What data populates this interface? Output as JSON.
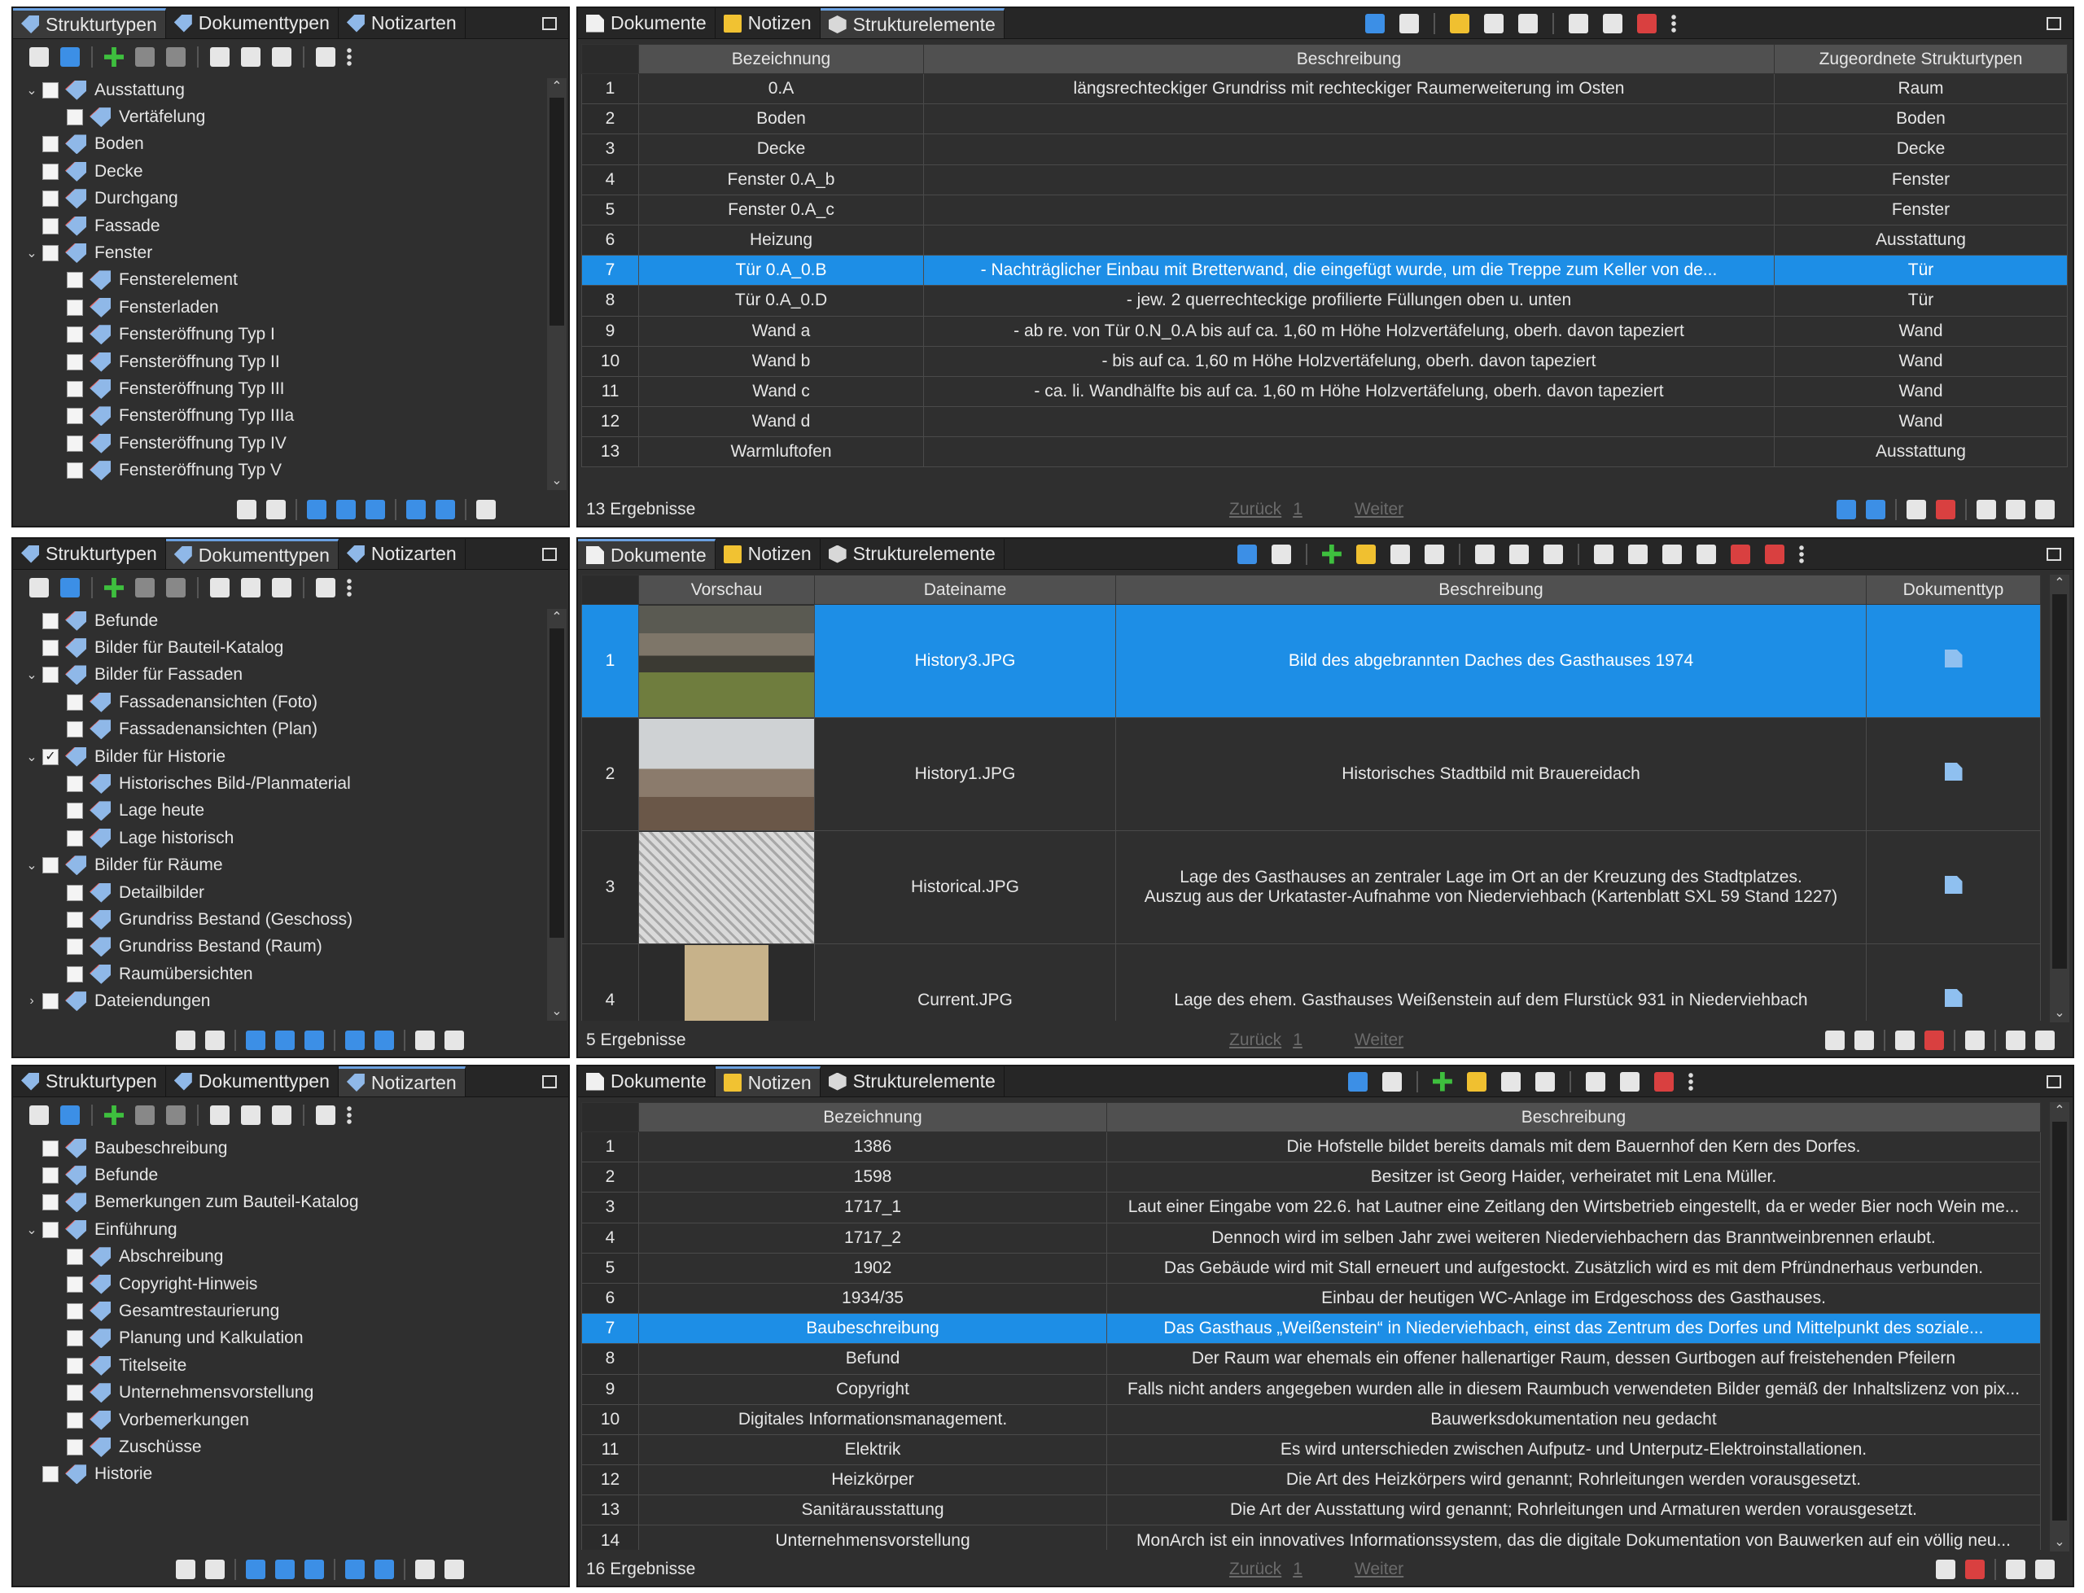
{
  "panels": [
    {
      "left_tabs": [
        "Strukturtypen",
        "Dokumenttypen",
        "Notizarten"
      ],
      "left_active": 0,
      "tree": [
        {
          "label": "Ausstattung",
          "level": 0,
          "exp": "open",
          "checked": false
        },
        {
          "label": "Vertäfelung",
          "level": 1,
          "exp": "",
          "checked": false
        },
        {
          "label": "Boden",
          "level": 0,
          "exp": "",
          "checked": false
        },
        {
          "label": "Decke",
          "level": 0,
          "exp": "",
          "checked": false
        },
        {
          "label": "Durchgang",
          "level": 0,
          "exp": "",
          "checked": false
        },
        {
          "label": "Fassade",
          "level": 0,
          "exp": "",
          "checked": false
        },
        {
          "label": "Fenster",
          "level": 0,
          "exp": "open",
          "checked": false
        },
        {
          "label": "Fensterelement",
          "level": 1,
          "exp": "",
          "checked": false
        },
        {
          "label": "Fensterladen",
          "level": 1,
          "exp": "",
          "checked": false
        },
        {
          "label": "Fensteröffnung Typ I",
          "level": 1,
          "exp": "",
          "checked": false
        },
        {
          "label": "Fensteröffnung Typ II",
          "level": 1,
          "exp": "",
          "checked": false
        },
        {
          "label": "Fensteröffnung Typ III",
          "level": 1,
          "exp": "",
          "checked": false
        },
        {
          "label": "Fensteröffnung Typ IIIa",
          "level": 1,
          "exp": "",
          "checked": false
        },
        {
          "label": "Fensteröffnung Typ IV",
          "level": 1,
          "exp": "",
          "checked": false
        },
        {
          "label": "Fensteröffnung Typ V",
          "level": 1,
          "exp": "",
          "checked": false
        }
      ],
      "right_tabs": [
        "Dokumente",
        "Notizen",
        "Strukturelemente"
      ],
      "right_active": 2,
      "columns": [
        "Bezeichnung",
        "Beschreibung",
        "Zugeordnete Strukturtypen"
      ],
      "rows": [
        {
          "n": "1",
          "c": [
            "0.A",
            "längsrechteckiger Grundriss mit rechteckiger Raumerweiterung im Osten",
            "Raum"
          ]
        },
        {
          "n": "2",
          "c": [
            "Boden",
            "",
            "Boden"
          ]
        },
        {
          "n": "3",
          "c": [
            "Decke",
            "",
            "Decke"
          ]
        },
        {
          "n": "4",
          "c": [
            "Fenster 0.A_b",
            "",
            "Fenster"
          ]
        },
        {
          "n": "5",
          "c": [
            "Fenster 0.A_c",
            "",
            "Fenster"
          ]
        },
        {
          "n": "6",
          "c": [
            "Heizung",
            "",
            "Ausstattung"
          ]
        },
        {
          "n": "7",
          "c": [
            "Tür 0.A_0.B",
            "- Nachträglicher Einbau mit Bretterwand, die eingefügt wurde, um die Treppe zum Keller von de...",
            "Tür"
          ],
          "sel": true
        },
        {
          "n": "8",
          "c": [
            "Tür 0.A_0.D",
            "- jew. 2 querrechteckige profilierte Füllungen oben u. unten",
            "Tür"
          ]
        },
        {
          "n": "9",
          "c": [
            "Wand a",
            "- ab re. von Tür 0.N_0.A bis auf ca. 1,60 m Höhe Holzvertäfelung, oberh. davon tapeziert",
            "Wand"
          ]
        },
        {
          "n": "10",
          "c": [
            "Wand b",
            "- bis auf ca. 1,60 m Höhe Holzvertäfelung, oberh. davon tapeziert",
            "Wand"
          ]
        },
        {
          "n": "11",
          "c": [
            "Wand c",
            "- ca. li. Wandhälfte bis auf ca. 1,60 m Höhe Holzvertäfelung, oberh. davon tapeziert",
            "Wand"
          ]
        },
        {
          "n": "12",
          "c": [
            "Wand d",
            "",
            "Wand"
          ]
        },
        {
          "n": "13",
          "c": [
            "Warmluftofen",
            "",
            "Ausstattung"
          ]
        }
      ],
      "status": "13 Ergebnisse",
      "pager": {
        "back": "Zurück",
        "page": "1",
        "next": "Weiter"
      }
    },
    {
      "left_tabs": [
        "Strukturtypen",
        "Dokumenttypen",
        "Notizarten"
      ],
      "left_active": 1,
      "tree": [
        {
          "label": "Befunde",
          "level": 0,
          "exp": "",
          "checked": false
        },
        {
          "label": "Bilder für Bauteil-Katalog",
          "level": 0,
          "exp": "",
          "checked": false
        },
        {
          "label": "Bilder für Fassaden",
          "level": 0,
          "exp": "open",
          "checked": false
        },
        {
          "label": "Fassadenansichten (Foto)",
          "level": 1,
          "exp": "",
          "checked": false
        },
        {
          "label": "Fassadenansichten (Plan)",
          "level": 1,
          "exp": "",
          "checked": false
        },
        {
          "label": "Bilder für Historie",
          "level": 0,
          "exp": "open",
          "checked": true
        },
        {
          "label": "Historisches Bild-/Planmaterial",
          "level": 1,
          "exp": "",
          "checked": false
        },
        {
          "label": "Lage heute",
          "level": 1,
          "exp": "",
          "checked": false
        },
        {
          "label": "Lage historisch",
          "level": 1,
          "exp": "",
          "checked": false
        },
        {
          "label": "Bilder für Räume",
          "level": 0,
          "exp": "open",
          "checked": false
        },
        {
          "label": "Detailbilder",
          "level": 1,
          "exp": "",
          "checked": false
        },
        {
          "label": "Grundriss Bestand (Geschoss)",
          "level": 1,
          "exp": "",
          "checked": false
        },
        {
          "label": "Grundriss Bestand (Raum)",
          "level": 1,
          "exp": "",
          "checked": false
        },
        {
          "label": "Raumübersichten",
          "level": 1,
          "exp": "",
          "checked": false
        },
        {
          "label": "Dateiendungen",
          "level": 0,
          "exp": "closed",
          "checked": false
        }
      ],
      "right_tabs": [
        "Dokumente",
        "Notizen",
        "Strukturelemente"
      ],
      "right_active": 0,
      "columns": [
        "Vorschau",
        "Dateiname",
        "Beschreibung",
        "Dokumenttyp"
      ],
      "rows": [
        {
          "n": "1",
          "file": "History3.JPG",
          "desc": "Bild des abgebrannten Daches des Gasthauses 1974",
          "desc2": "",
          "sel": true,
          "img": "fire"
        },
        {
          "n": "2",
          "file": "History1.JPG",
          "desc": "Historisches Stadtbild mit Brauereidach",
          "desc2": "",
          "img": "city"
        },
        {
          "n": "3",
          "file": "Historical.JPG",
          "desc": "Lage des Gasthauses an zentraler Lage im Ort an der Kreuzung des Stadtplatzes.",
          "desc2": "Auszug aus der Urkataster-Aufnahme von Niederviehbach (Kartenblatt SXL 59 Stand 1227)",
          "img": "map"
        },
        {
          "n": "4",
          "file": "Current.JPG",
          "desc": "Lage des ehem. Gasthauses Weißenstein auf dem Flurstück 931 in Niederviehbach",
          "desc2": "",
          "img": "aerial"
        }
      ],
      "status": "5 Ergebnisse",
      "pager": {
        "back": "Zurück",
        "page": "1",
        "next": "Weiter"
      }
    },
    {
      "left_tabs": [
        "Strukturtypen",
        "Dokumenttypen",
        "Notizarten"
      ],
      "left_active": 2,
      "tree": [
        {
          "label": "Baubeschreibung",
          "level": 0,
          "exp": "",
          "checked": false
        },
        {
          "label": "Befunde",
          "level": 0,
          "exp": "",
          "checked": false
        },
        {
          "label": "Bemerkungen zum Bauteil-Katalog",
          "level": 0,
          "exp": "",
          "checked": false
        },
        {
          "label": "Einführung",
          "level": 0,
          "exp": "open",
          "checked": false
        },
        {
          "label": "Abschreibung",
          "level": 1,
          "exp": "",
          "checked": false
        },
        {
          "label": "Copyright-Hinweis",
          "level": 1,
          "exp": "",
          "checked": false
        },
        {
          "label": "Gesamtrestaurierung",
          "level": 1,
          "exp": "",
          "checked": false
        },
        {
          "label": "Planung und Kalkulation",
          "level": 1,
          "exp": "",
          "checked": false
        },
        {
          "label": "Titelseite",
          "level": 1,
          "exp": "",
          "checked": false
        },
        {
          "label": "Unternehmensvorstellung",
          "level": 1,
          "exp": "",
          "checked": false
        },
        {
          "label": "Vorbemerkungen",
          "level": 1,
          "exp": "",
          "checked": false
        },
        {
          "label": "Zuschüsse",
          "level": 1,
          "exp": "",
          "checked": false
        },
        {
          "label": "Historie",
          "level": 0,
          "exp": "",
          "checked": false
        }
      ],
      "right_tabs": [
        "Dokumente",
        "Notizen",
        "Strukturelemente"
      ],
      "right_active": 1,
      "columns": [
        "Bezeichnung",
        "Beschreibung"
      ],
      "rows": [
        {
          "n": "1",
          "c": [
            "1386",
            "Die Hofstelle bildet bereits damals mit dem Bauernhof den Kern des Dorfes."
          ]
        },
        {
          "n": "2",
          "c": [
            "1598",
            "Besitzer ist Georg Haider, verheiratet mit Lena Müller."
          ]
        },
        {
          "n": "3",
          "c": [
            "1717_1",
            "Laut einer Eingabe vom 22.6. hat Lautner eine Zeitlang den Wirtsbetrieb eingestellt, da er weder Bier noch Wein me..."
          ]
        },
        {
          "n": "4",
          "c": [
            "1717_2",
            "Dennoch wird im selben Jahr zwei weiteren Niederviehbachern das Branntweinbrennen erlaubt."
          ]
        },
        {
          "n": "5",
          "c": [
            "1902",
            "Das Gebäude wird mit Stall erneuert und aufgestockt. Zusätzlich wird es mit dem Pfründnerhaus verbunden."
          ]
        },
        {
          "n": "6",
          "c": [
            "1934/35",
            "Einbau der heutigen WC-Anlage im Erdgeschoss des Gasthauses."
          ]
        },
        {
          "n": "7",
          "c": [
            "Baubeschreibung",
            "Das Gasthaus „Weißenstein“ in Niederviehbach, einst das Zentrum des Dorfes und Mittelpunkt des soziale..."
          ],
          "sel": true
        },
        {
          "n": "8",
          "c": [
            "Befund",
            "Der Raum war ehemals ein offener hallenartiger Raum, dessen Gurtbogen auf freistehenden Pfeilern"
          ]
        },
        {
          "n": "9",
          "c": [
            "Copyright",
            "Falls nicht anders angegeben wurden alle in diesem Raumbuch verwendeten Bilder gemäß der Inhaltslizenz von pix..."
          ]
        },
        {
          "n": "10",
          "c": [
            "Digitales Informationsmanagement.",
            "Bauwerksdokumentation neu gedacht"
          ]
        },
        {
          "n": "11",
          "c": [
            "Elektrik",
            "Es wird unterschieden zwischen Aufputz- und Unterputz-Elektroinstallationen."
          ]
        },
        {
          "n": "12",
          "c": [
            "Heizkörper",
            "Die Art des Heizkörpers wird genannt; Rohrleitungen werden vorausgesetzt."
          ]
        },
        {
          "n": "13",
          "c": [
            "Sanitärausstattung",
            "Die Art der Ausstattung wird genannt; Rohrleitungen und Armaturen werden vorausgesetzt."
          ]
        },
        {
          "n": "14",
          "c": [
            "Unternehmensvorstellung",
            "MonArch ist ein innovatives Informationssystem, das die digitale Dokumentation von Bauwerken auf ein völlig neu..."
          ]
        }
      ],
      "status": "16 Ergebnisse",
      "pager": {
        "back": "Zurück",
        "page": "1",
        "next": "Weiter"
      }
    }
  ],
  "colors": {
    "selection": "#1d8ee6",
    "panel_bg": "#2f2f2f",
    "header_bg": "#505050"
  }
}
